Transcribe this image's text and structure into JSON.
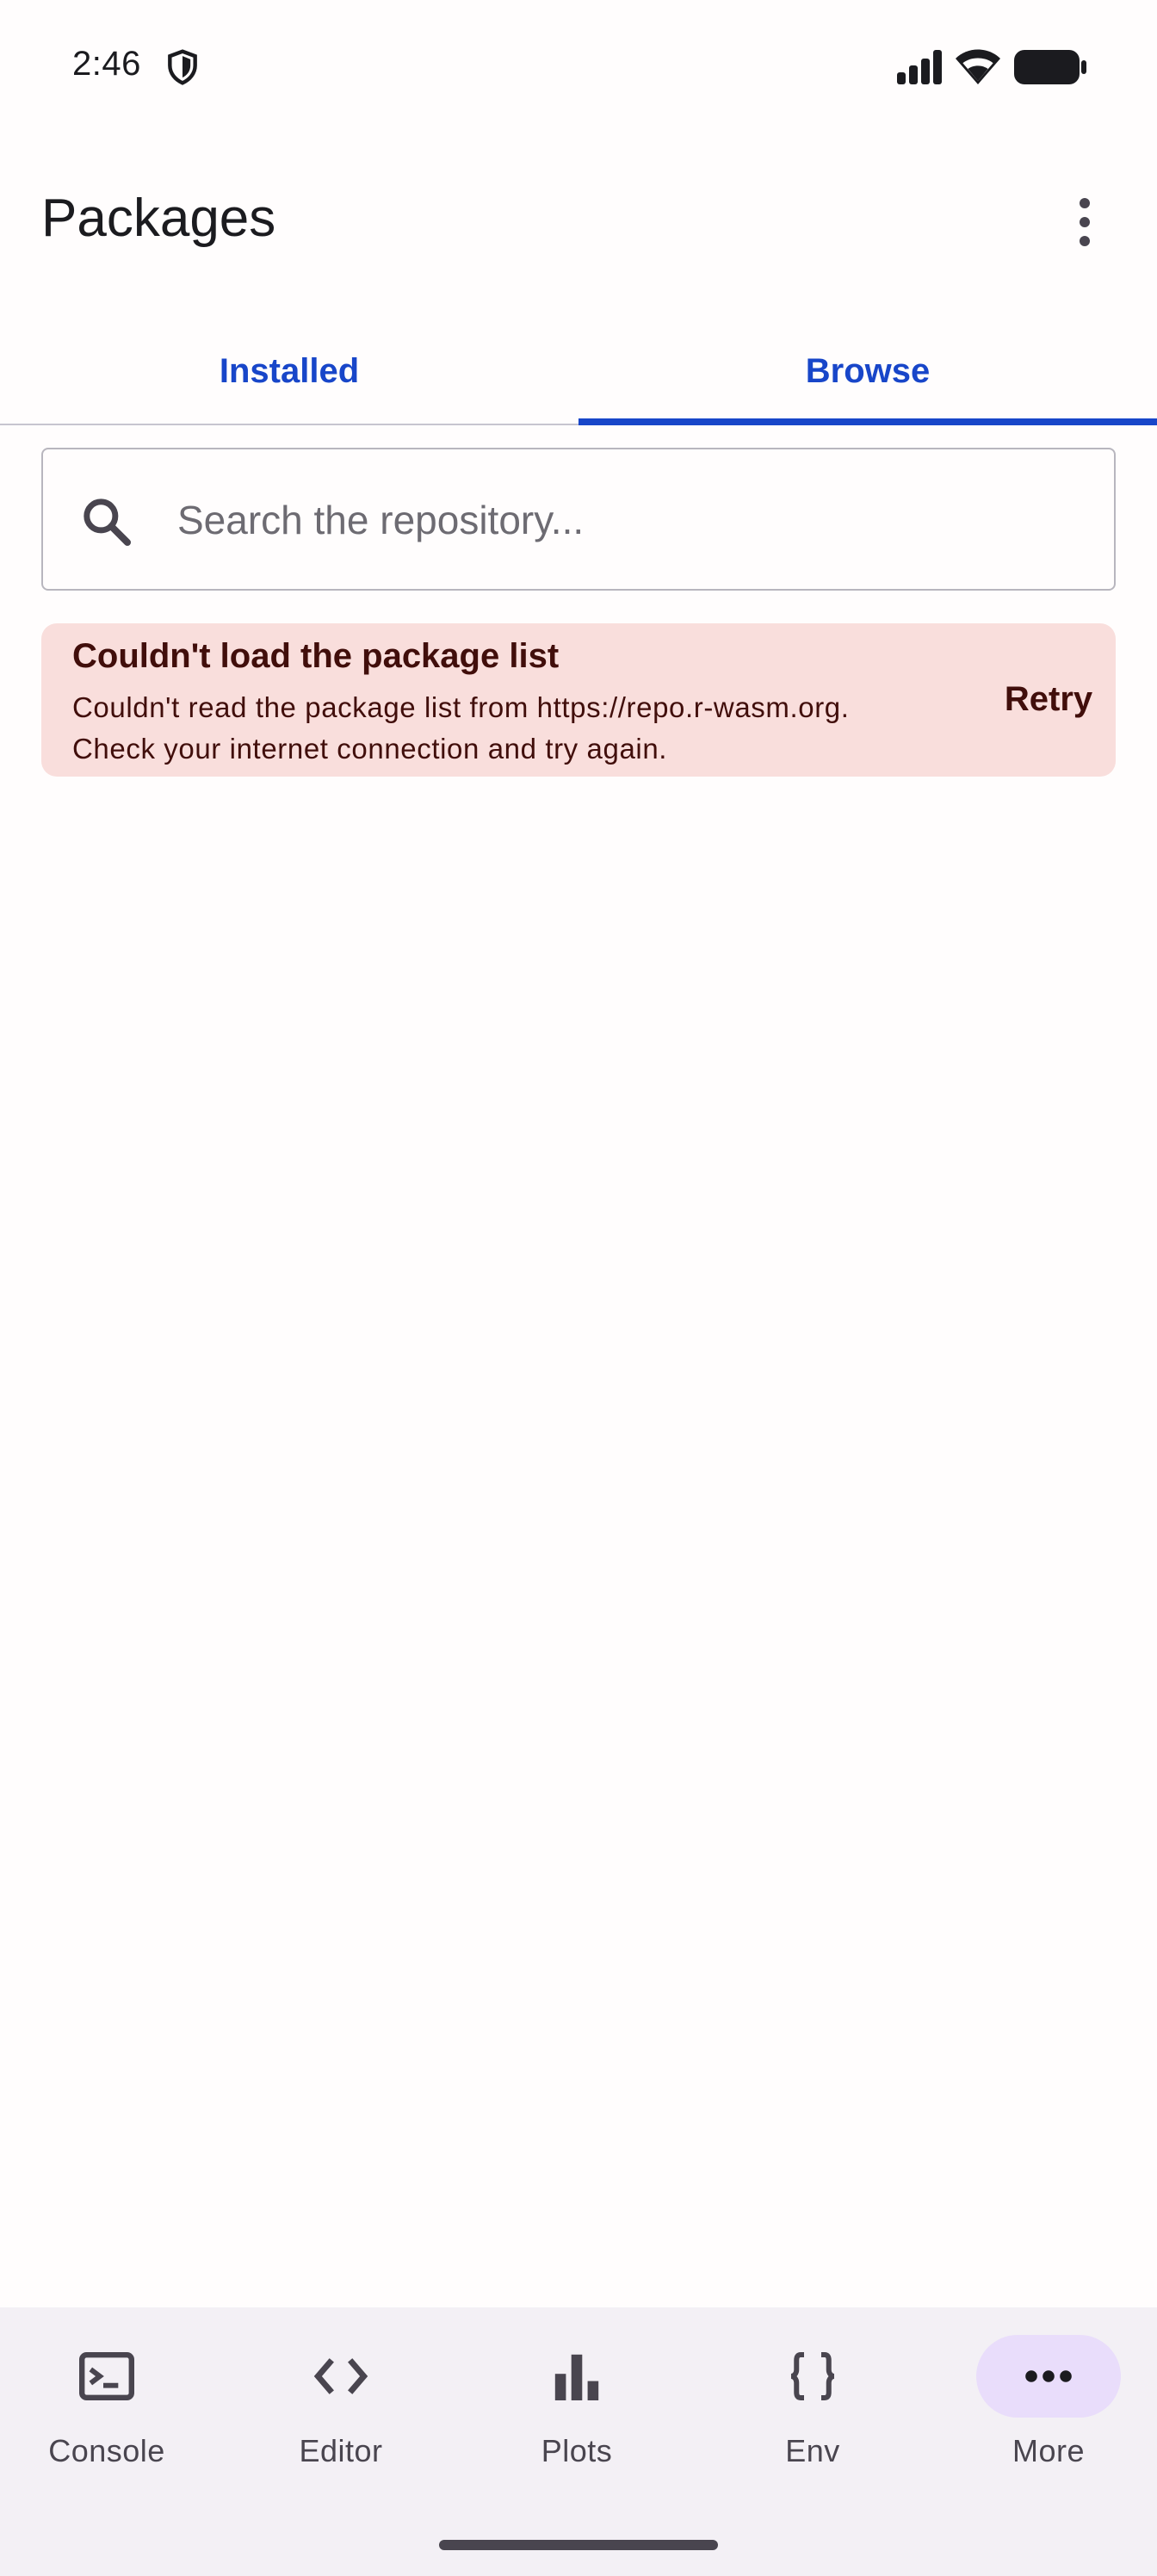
{
  "status_bar": {
    "time": "2:46",
    "icons": [
      "shield-icon",
      "signal-icon",
      "wifi-icon",
      "battery-icon"
    ]
  },
  "app_bar": {
    "title": "Packages",
    "overflow_icon": "more-vert-icon"
  },
  "tabs": [
    {
      "label": "Installed",
      "active": false
    },
    {
      "label": "Browse",
      "active": true
    }
  ],
  "search": {
    "placeholder": "Search the repository...",
    "value": "",
    "icon": "search-icon"
  },
  "error": {
    "title": "Couldn't load the package list",
    "message": "Couldn't read the package list from https://repo.r-wasm.org.\nCheck your internet connection and try again.",
    "action_label": "Retry"
  },
  "bottom_nav": {
    "items": [
      {
        "label": "Console",
        "icon": "terminal-icon",
        "active": false
      },
      {
        "label": "Editor",
        "icon": "code-icon",
        "active": false
      },
      {
        "label": "Plots",
        "icon": "bar-chart-icon",
        "active": false
      },
      {
        "label": "Env",
        "icon": "braces-icon",
        "active": false
      },
      {
        "label": "More",
        "icon": "more-horiz-icon",
        "active": true
      }
    ]
  },
  "colors": {
    "accent": "#1846c9",
    "error_container": "#f9dedc",
    "on_error_container": "#410e0b",
    "nav_active_indicator": "#e9ddfb",
    "nav_background": "#f3f0f5"
  }
}
